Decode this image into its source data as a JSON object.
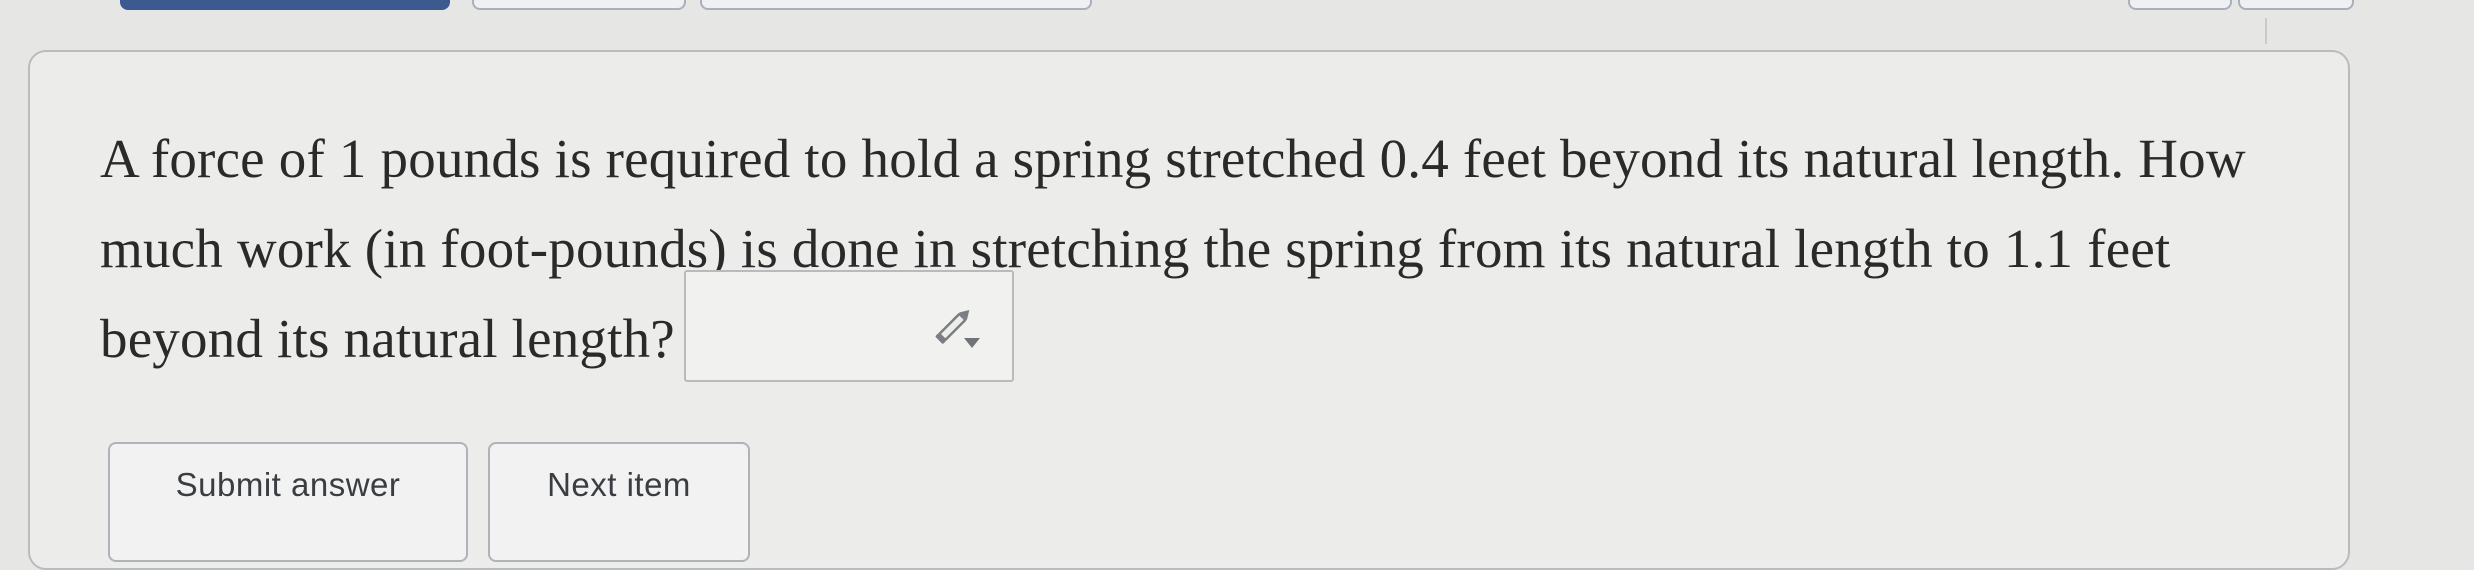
{
  "question": {
    "line1": "A force of 1 pounds is required to hold a spring stretched 0.4 feet beyond its natural length. How",
    "line2": "much work (in foot-pounds) is done in stretching the spring from its natural length to 1.1 feet",
    "line3": "beyond its natural length?"
  },
  "answer_input": {
    "value": "",
    "icon": "pencil-dropdown-icon"
  },
  "buttons": {
    "submit_label": "Submit answer",
    "next_label": "Next item"
  },
  "colors": {
    "background": "#e6e7e5",
    "card": "#ececea",
    "active_tab": "#3c5a8f",
    "text": "#2a2a2a",
    "pencil_icon": "#707478"
  }
}
